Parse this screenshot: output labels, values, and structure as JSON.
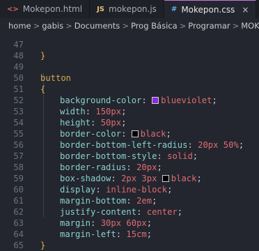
{
  "tabs": [
    {
      "icon": "<>",
      "label": "Mokepon.html"
    },
    {
      "icon": "JS",
      "label": "mokepon.js"
    },
    {
      "icon": "#",
      "label": "Mokepon.css",
      "close": "×"
    }
  ],
  "breadcrumb": [
    "home",
    "gabis",
    "Documents",
    "Prog Básica",
    "Programar",
    "MOKEPON",
    "#"
  ],
  "breadcrumb_sep": ">",
  "colors": {
    "blueviolet": "#8a2be2",
    "black": "#000000"
  },
  "code": {
    "l47": {
      "num": "47",
      "text": "}"
    },
    "l48": {
      "num": "48"
    },
    "l49": {
      "num": "49",
      "text": "button"
    },
    "l50": {
      "num": "50",
      "text": "{"
    },
    "l51": {
      "num": "51",
      "prop": "background-color",
      "value": "blueviolet"
    },
    "l52": {
      "num": "52",
      "prop": "width",
      "value": "150px"
    },
    "l53": {
      "num": "53",
      "prop": "height",
      "value": "50px"
    },
    "l54": {
      "num": "54",
      "prop": "border-color",
      "value": "black"
    },
    "l55": {
      "num": "55",
      "prop": "border-bottom-left-radius",
      "value": "20px 50%"
    },
    "l56": {
      "num": "56",
      "prop": "border-bottom-style",
      "value": "solid"
    },
    "l57": {
      "num": "57",
      "prop": "border-radius",
      "value": "20px"
    },
    "l58": {
      "num": "58",
      "prop": "box-shadow",
      "value_a": "2px 3px",
      "value_b": "black"
    },
    "l59": {
      "num": "59",
      "prop": "display",
      "value": "inline-block"
    },
    "l60": {
      "num": "60",
      "prop": "margin-bottom",
      "value": "2em"
    },
    "l61": {
      "num": "61",
      "prop": "justify-content",
      "value": "center"
    },
    "l62": {
      "num": "62",
      "prop": "margin",
      "value": "30px 60px"
    },
    "l63": {
      "num": "63",
      "prop": "margin-left",
      "value": "15cm"
    },
    "l64": {
      "num": "64",
      "text": "}"
    },
    "l65": {
      "num": "65"
    }
  },
  "punct": {
    "colon": ": ",
    "semicolon": ";"
  }
}
